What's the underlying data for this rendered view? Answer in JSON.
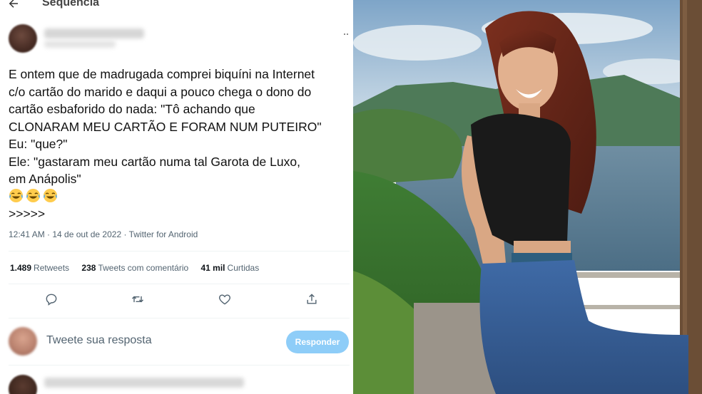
{
  "header": {
    "title": "Sequência"
  },
  "tweet": {
    "lines": [
      "E ontem que de madrugada comprei biquíni na Internet",
      "c/o cartão do marido e daqui a pouco chega o dono do",
      "cartão esbaforido do nada: \"Tô achando que",
      "CLONARAM MEU CARTÃO E FORAM NUM PUTEIRO\"",
      "Eu: \"que?\"",
      "Ele: \"gastaram meu cartão numa tal Garota de Luxo,",
      "em Anápolis\""
    ],
    "emojis": [
      "face-with-tears-of-joy",
      "face-with-tears-of-joy",
      "face-with-tears-of-joy"
    ],
    "last_line": ">>>>>",
    "meta": "12:41 AM · 14 de out de 2022 · Twitter for Android"
  },
  "stats": {
    "retweets_count": "1.489",
    "retweets_label": "Retweets",
    "quotes_count": "238",
    "quotes_label": "Tweets com comentário",
    "likes_count": "41 mil",
    "likes_label": "Curtidas"
  },
  "actions": [
    "reply-icon",
    "retweet-icon",
    "like-icon",
    "share-icon"
  ],
  "reply": {
    "placeholder": "Tweete sua resposta",
    "button_label": "Responder"
  },
  "colors": {
    "accent_disabled": "#8ecdf8",
    "muted_text": "#536471",
    "divider": "#eff3f4"
  }
}
